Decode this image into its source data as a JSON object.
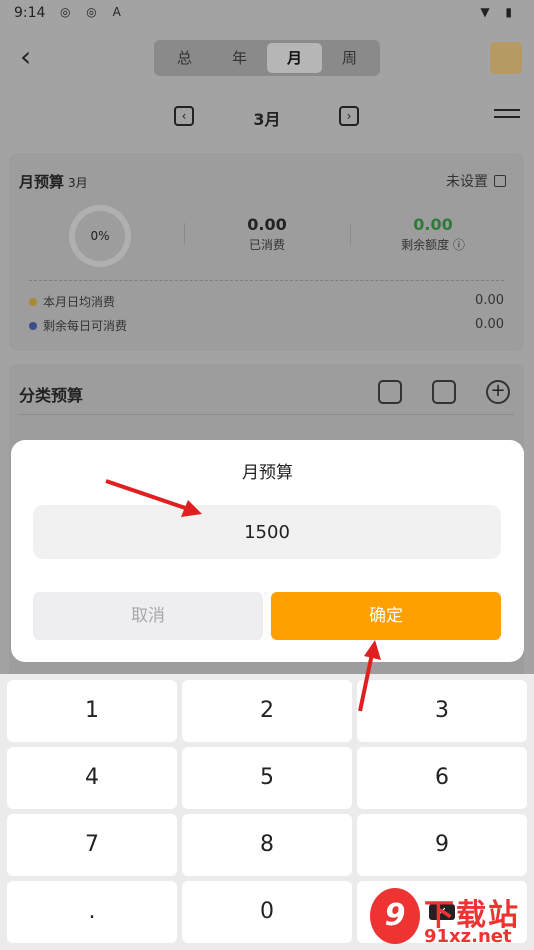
{
  "status_bar": {
    "time": "9:14",
    "left_icons": "◎ ◎ A",
    "right_icons": "▼ ▮"
  },
  "header": {
    "tabs": [
      {
        "label": "总",
        "active": false
      },
      {
        "label": "年",
        "active": false
      },
      {
        "label": "月",
        "active": true
      },
      {
        "label": "周",
        "active": false
      }
    ],
    "month": "3月"
  },
  "monthly_budget": {
    "title": "月预算",
    "subtitle": "3月",
    "status": "未设置",
    "progress": "0%",
    "spent_value": "0.00",
    "spent_label": "已消费",
    "remaining_value": "0.00",
    "remaining_label": "剩余额度 ⓘ",
    "daily_avg_label": "本月日均消费",
    "daily_avg_value": "0.00",
    "daily_left_label": "剩余每日可消费",
    "daily_left_value": "0.00"
  },
  "category_budget": {
    "title": "分类预算"
  },
  "dialog": {
    "title": "月预算",
    "amount": "1500",
    "cancel_label": "取消",
    "confirm_label": "确定"
  },
  "keypad": {
    "keys": [
      "1",
      "2",
      "3",
      "4",
      "5",
      "6",
      "7",
      "8",
      "9",
      ".",
      "0"
    ],
    "delete_label": "✕"
  },
  "watermark": {
    "logo": "9",
    "top": "下载站",
    "bottom": "91xz.net"
  },
  "colors": {
    "accent": "#ff9f00",
    "remaining_green": "#2f7a3a",
    "arrow": "#e02020"
  }
}
